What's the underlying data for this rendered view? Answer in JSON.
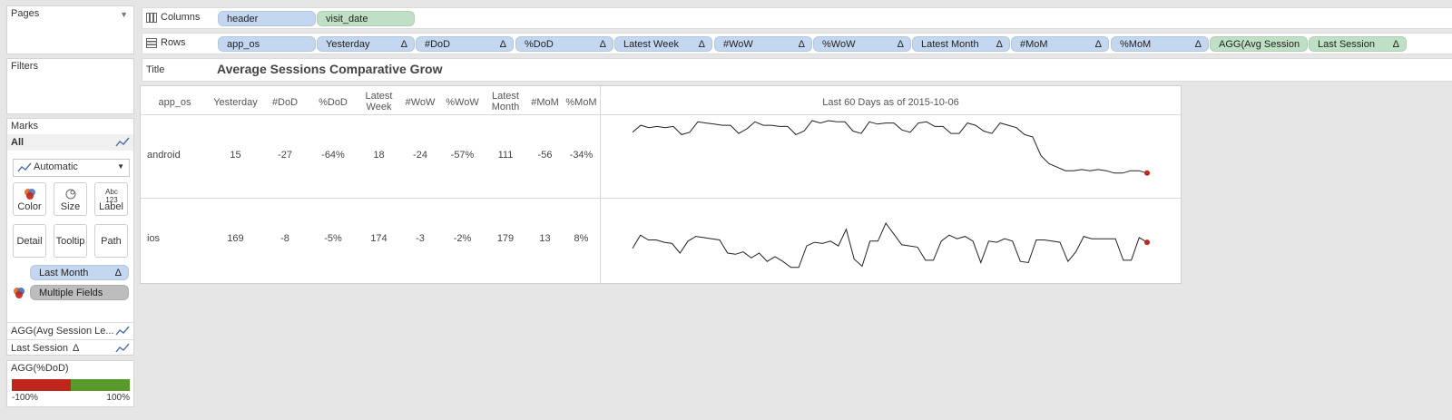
{
  "sidebar": {
    "pages_title": "Pages",
    "filters_title": "Filters",
    "marks_title": "Marks",
    "marks_all": "All",
    "mark_type": "Automatic",
    "buttons": [
      "Color",
      "Size",
      "Label",
      "Detail",
      "Tooltip",
      "Path"
    ],
    "label_icon": "Abc 123",
    "last_month_pill": "Last Month",
    "last_month_delta": "Δ",
    "multiple_fields_pill": "Multiple Fields",
    "agg_avg_session": "AGG(Avg Session Le...",
    "last_session": "Last Session",
    "last_session_delta": "Δ",
    "legend_title": "AGG(%DoD)",
    "legend_min": "-100%",
    "legend_max": "100%",
    "legend_neg_color": "#c0261b",
    "legend_pos_color": "#5a9a2d"
  },
  "shelves": {
    "columns_label": "Columns",
    "rows_label": "Rows",
    "title_label": "Title",
    "columns": [
      "header",
      "visit_date"
    ],
    "rows": [
      {
        "label": "app_os",
        "delta": ""
      },
      {
        "label": "Yesterday",
        "delta": "Δ"
      },
      {
        "label": "#DoD",
        "delta": "Δ"
      },
      {
        "label": "%DoD",
        "delta": "Δ"
      },
      {
        "label": "Latest  Week",
        "delta": "Δ"
      },
      {
        "label": "#WoW",
        "delta": "Δ"
      },
      {
        "label": "%WoW",
        "delta": "Δ"
      },
      {
        "label": "Latest Month",
        "delta": "Δ"
      },
      {
        "label": "#MoM",
        "delta": "Δ"
      },
      {
        "label": "%MoM",
        "delta": "Δ"
      },
      {
        "label": "AGG(Avg Session ..",
        "delta": ""
      },
      {
        "label": "Last Session",
        "delta": "Δ"
      }
    ]
  },
  "viz": {
    "title": "Average Sessions Comparative Grow",
    "columns": [
      "app_os",
      "Yesterday",
      "#DoD",
      "%DoD",
      "Latest Week",
      "#WoW",
      "%WoW",
      "Latest Month",
      "#MoM",
      "%MoM"
    ],
    "spark_header": "Last 60 Days as of 2015-10-06",
    "rows": [
      {
        "values": [
          "android",
          "15",
          "-27",
          "-64%",
          "18",
          "-24",
          "-57%",
          "111",
          "-56",
          "-34%"
        ]
      },
      {
        "values": [
          "ios",
          "169",
          "-8",
          "-5%",
          "174",
          "-3",
          "-2%",
          "179",
          "13",
          "8%"
        ]
      }
    ],
    "last_point_color": "#c0261b"
  },
  "chart_data": {
    "type": "line",
    "x_label": "Last 60 Days as of 2015-10-06",
    "series": [
      {
        "name": "android",
        "values": [
          100,
          112,
          108,
          110,
          108,
          110,
          96,
          100,
          118,
          116,
          114,
          112,
          112,
          98,
          106,
          118,
          112,
          112,
          110,
          110,
          96,
          102,
          120,
          116,
          120,
          118,
          118,
          102,
          98,
          118,
          114,
          116,
          116,
          104,
          100,
          116,
          118,
          110,
          110,
          98,
          98,
          116,
          112,
          102,
          98,
          116,
          112,
          108,
          96,
          92,
          60,
          46,
          40,
          34,
          34,
          36,
          34,
          36,
          34,
          30,
          30,
          34,
          34,
          30
        ]
      },
      {
        "name": "ios",
        "values": [
          46,
          68,
          60,
          60,
          56,
          54,
          38,
          58,
          66,
          64,
          62,
          60,
          38,
          36,
          40,
          30,
          38,
          24,
          32,
          24,
          14,
          14,
          50,
          56,
          54,
          58,
          50,
          78,
          28,
          16,
          58,
          58,
          88,
          70,
          52,
          50,
          48,
          26,
          26,
          58,
          68,
          62,
          66,
          58,
          22,
          58,
          56,
          62,
          58,
          24,
          22,
          60,
          60,
          58,
          56,
          24,
          40,
          66,
          62,
          62,
          62,
          62,
          26,
          26,
          64,
          56
        ]
      }
    ]
  }
}
